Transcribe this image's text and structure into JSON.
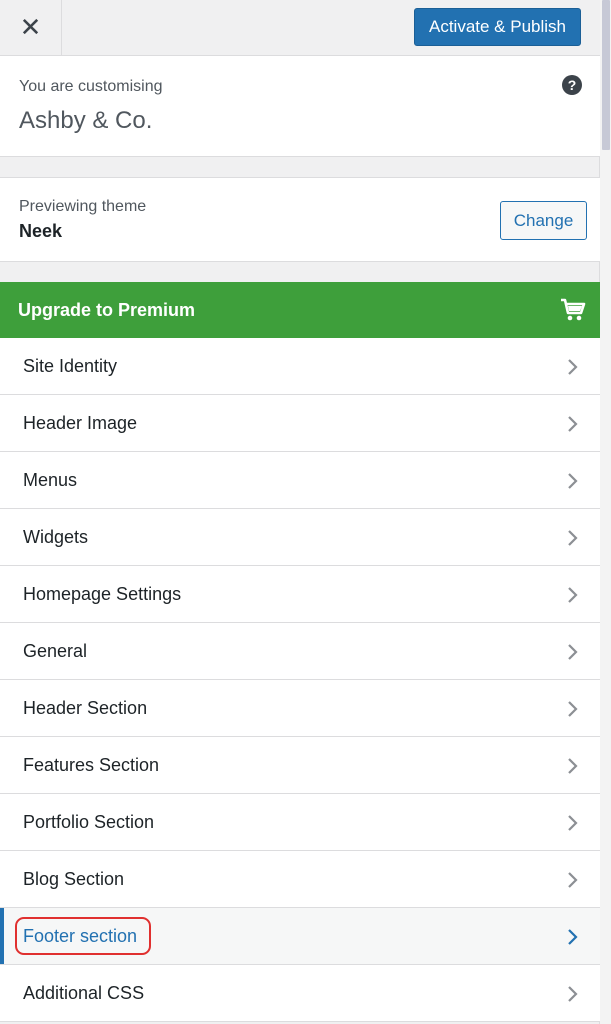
{
  "topbar": {
    "close_glyph": "✕",
    "publish_label": "Activate & Publish"
  },
  "info": {
    "pre": "You are customising",
    "title": "Ashby & Co.",
    "help_glyph": "?"
  },
  "theme": {
    "pre": "Previewing theme",
    "name": "Neek",
    "change_label": "Change"
  },
  "upgrade": {
    "label": "Upgrade to Premium",
    "icon": "cart-icon"
  },
  "menu": {
    "items": [
      {
        "label": "Site Identity"
      },
      {
        "label": "Header Image"
      },
      {
        "label": "Menus"
      },
      {
        "label": "Widgets"
      },
      {
        "label": "Homepage Settings"
      },
      {
        "label": "General"
      },
      {
        "label": "Header Section"
      },
      {
        "label": "Features Section"
      },
      {
        "label": "Portfolio Section"
      },
      {
        "label": "Blog Section"
      },
      {
        "label": "Footer section"
      },
      {
        "label": "Additional CSS"
      }
    ],
    "active_index": 10
  },
  "colors": {
    "accent": "#2271b1",
    "upgrade_bg": "#3e9f3b",
    "highlight": "#e0302f"
  }
}
